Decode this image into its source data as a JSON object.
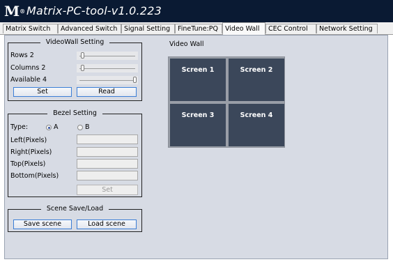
{
  "app": {
    "logo": "M",
    "logo_mark": "®",
    "title": "Matrix-PC-tool-v1.0.223"
  },
  "tabs": [
    {
      "label": "Matrix Switch"
    },
    {
      "label": "Advanced Switch"
    },
    {
      "label": "Signal Setting"
    },
    {
      "label": "FineTune:PQ"
    },
    {
      "label": "Video Wall",
      "active": true
    },
    {
      "label": "CEC Control"
    },
    {
      "label": "Network Setting"
    }
  ],
  "videowall_setting": {
    "title": "VideoWall Setting",
    "rows": {
      "label": "Rows",
      "value": "2",
      "level": 0.05
    },
    "columns": {
      "label": "Columns",
      "value": "2",
      "level": 0.05
    },
    "available": {
      "label": "Available",
      "value": "4",
      "level": 1.0
    },
    "set_label": "Set",
    "read_label": "Read"
  },
  "bezel_setting": {
    "title": "Bezel Setting",
    "type_label": "Type:",
    "option_a": "A",
    "option_b": "B",
    "selected": "A",
    "left_label": "Left(Pixels)",
    "right_label": "Right(Pixels)",
    "top_label": "Top(Pixels)",
    "bottom_label": "Bottom(Pixels)",
    "set_label": "Set"
  },
  "scene": {
    "title": "Scene Save/Load",
    "save_label": "Save scene",
    "load_label": "Load scene"
  },
  "video_wall": {
    "title": "Video Wall",
    "screens": [
      "Screen 1",
      "Screen 2",
      "Screen 3",
      "Screen 4"
    ]
  },
  "colors": {
    "titlebar": "#0a1a33",
    "panel": "#d7dbe4",
    "screen": "#3b475a",
    "button_border": "#3b7ed6"
  }
}
